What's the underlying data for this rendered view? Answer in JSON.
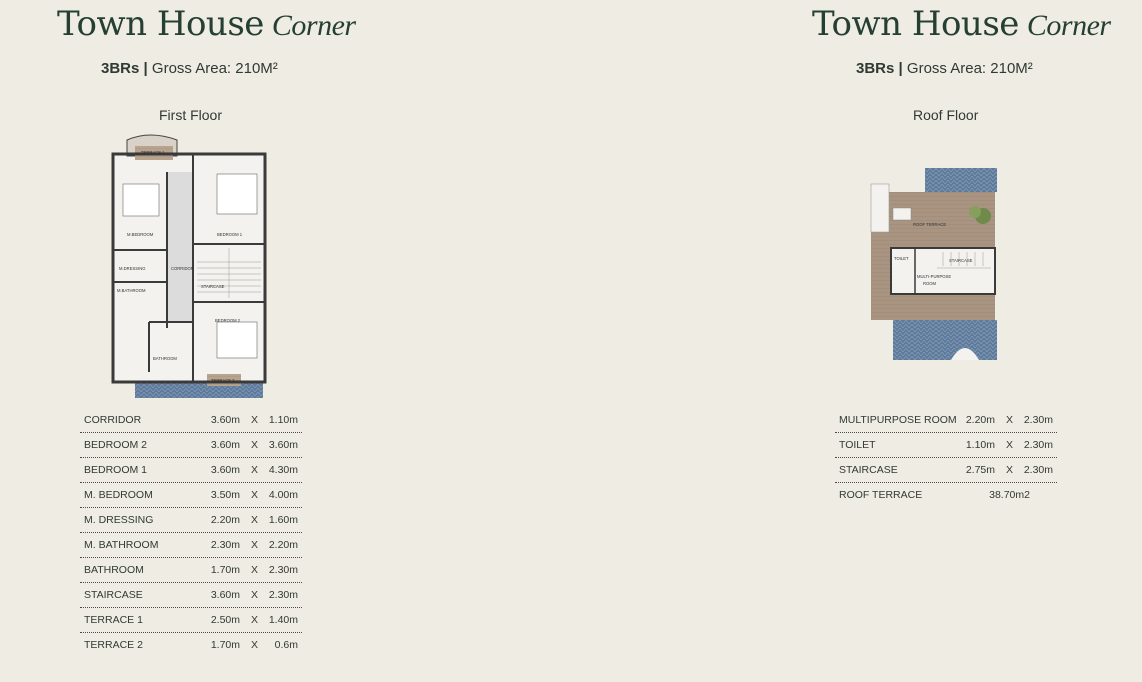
{
  "left": {
    "title_main": "Town House",
    "title_script": "Corner",
    "subtitle_bold": "3BRs",
    "subtitle_sep": "|",
    "subtitle_rest": "Gross Area: 210M²",
    "floor_label": "First Floor",
    "plan_labels": {
      "terrace_top": "TERRACE 1",
      "master_bedroom": "M.BEDROOM",
      "bedroom1": "BEDROOM 1",
      "dressing": "M.DRESSING",
      "corridor": "CORRIDOR",
      "staircase": "STAIRCASE",
      "m_bathroom": "M.BATHROOM",
      "bedroom2": "BEDROOM 2",
      "bathroom": "BATHROOM",
      "terrace_bottom": "TERRACE 2"
    },
    "rows": [
      {
        "name": "CORRIDOR",
        "w": "3.60m",
        "x": "X",
        "h": "1.10m"
      },
      {
        "name": "BEDROOM 2",
        "w": "3.60m",
        "x": "X",
        "h": "3.60m"
      },
      {
        "name": "BEDROOM 1",
        "w": "3.60m",
        "x": "X",
        "h": "4.30m"
      },
      {
        "name": "M. BEDROOM",
        "w": "3.50m",
        "x": "X",
        "h": "4.00m"
      },
      {
        "name": "M. DRESSING",
        "w": "2.20m",
        "x": "X",
        "h": "1.60m"
      },
      {
        "name": "M. BATHROOM",
        "w": "2.30m",
        "x": "X",
        "h": "2.20m"
      },
      {
        "name": "BATHROOM",
        "w": "1.70m",
        "x": "X",
        "h": "2.30m"
      },
      {
        "name": "STAIRCASE",
        "w": "3.60m",
        "x": "X",
        "h": "2.30m"
      },
      {
        "name": "TERRACE 1",
        "w": "2.50m",
        "x": "X",
        "h": "1.40m"
      },
      {
        "name": "TERRACE 2",
        "w": "1.70m",
        "x": "X",
        "h": "0.6m"
      }
    ]
  },
  "right": {
    "title_main": "Town House",
    "title_script": "Corner",
    "subtitle_bold": "3BRs",
    "subtitle_sep": "|",
    "subtitle_rest": "Gross Area: 210M²",
    "floor_label": "Roof Floor",
    "plan_labels": {
      "roof_terrace": "ROOF TERRACE",
      "toilet": "TOILET",
      "staircase": "STAIRCASE",
      "multipurpose_1": "MULTI-PURPOSE",
      "multipurpose_2": "ROOM"
    },
    "rows": [
      {
        "name": "MULTIPURPOSE ROOM",
        "w": "2.20m",
        "x": "X",
        "h": "2.30m"
      },
      {
        "name": "TOILET",
        "w": "1.10m",
        "x": "X",
        "h": "2.30m"
      },
      {
        "name": "STAIRCASE",
        "w": "2.75m",
        "x": "X",
        "h": "2.30m"
      }
    ],
    "area_row": {
      "name": "ROOF TERRACE",
      "value": "38.70m2"
    }
  },
  "colors": {
    "background": "#efece3",
    "title": "#263f33",
    "tile_blue": "#5d7a9c",
    "wood": "#a89480",
    "wall": "#3a3a3a"
  }
}
